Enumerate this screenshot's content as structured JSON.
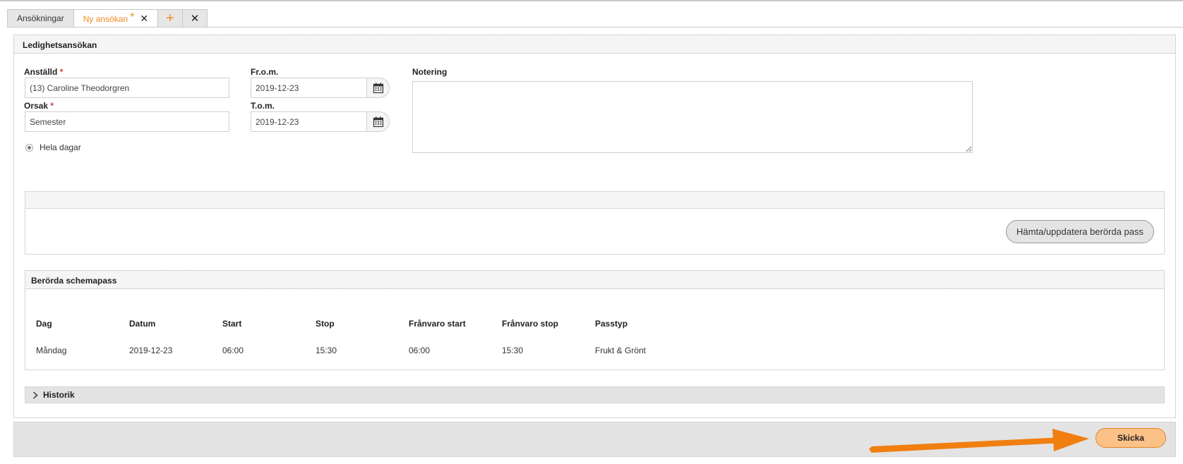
{
  "tabs": [
    {
      "label": "Ansökningar"
    },
    {
      "label": "Ny ansökan",
      "modified_mark": "*",
      "close": "✕"
    }
  ],
  "tab_actions": {
    "add": "+",
    "close_all": "✕"
  },
  "form": {
    "title": "Ledighetsansökan",
    "employee": {
      "label": "Anställd",
      "required_mark": "*",
      "value": "(13) Caroline Theodorgren"
    },
    "reason": {
      "label": "Orsak",
      "required_mark": "*",
      "value": "Semester"
    },
    "from": {
      "label": "Fr.o.m.",
      "value": "2019-12-23"
    },
    "to": {
      "label": "T.o.m.",
      "value": "2019-12-23"
    },
    "note": {
      "label": "Notering",
      "value": ""
    },
    "full_days": {
      "label": "Hela dagar",
      "checked": true
    }
  },
  "fetch_button": "Hämta/uppdatera berörda pass",
  "schedule": {
    "title": "Berörda schemapass",
    "columns": [
      "Dag",
      "Datum",
      "Start",
      "Stop",
      "Frånvaro start",
      "Frånvaro stop",
      "Passtyp"
    ],
    "rows": [
      [
        "Måndag",
        "2019-12-23",
        "06:00",
        "15:30",
        "06:00",
        "15:30",
        "Frukt & Grönt"
      ]
    ]
  },
  "history": {
    "label": "Historik"
  },
  "submit_button": "Skicka",
  "colors": {
    "accent": "#f08a24",
    "submit_bg": "#fcc187",
    "required": "#d23b3b",
    "arrow": "#f07f10"
  },
  "icons": {
    "calendar": "calendar-icon",
    "chevron": "chevron-right-icon",
    "arrow": "arrow-right-icon"
  }
}
